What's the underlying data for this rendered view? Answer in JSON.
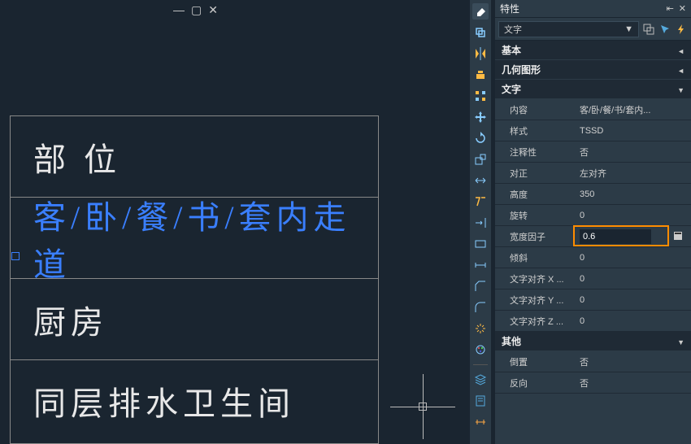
{
  "window_controls": {
    "min": "—",
    "restore": "▢",
    "close": "✕"
  },
  "canvas": {
    "rows": [
      "部 位",
      "客/卧/餐/书/套内走道",
      "厨房",
      "同层排水卫生间"
    ],
    "selected_index": 1
  },
  "panel": {
    "title": "特性",
    "selection_type": "文字",
    "dropdown_caret": "▼",
    "sections": {
      "basic": "基本",
      "geometry": "几何图形",
      "text": "文字",
      "other": "其他"
    },
    "text_props": {
      "content_label": "内容",
      "content": "客/卧/餐/书/套内...",
      "style_label": "样式",
      "style": "TSSD",
      "annotative_label": "注释性",
      "annotative": "否",
      "justify_label": "对正",
      "justify": "左对齐",
      "height_label": "高度",
      "height": "350",
      "rotation_label": "旋转",
      "rotation": "0",
      "width_factor_label": "宽度因子",
      "width_factor": "0.6",
      "oblique_label": "倾斜",
      "oblique": "0",
      "align_x_label": "文字对齐 X ...",
      "align_x": "0",
      "align_y_label": "文字对齐 Y ...",
      "align_y": "0",
      "align_z_label": "文字对齐 Z ...",
      "align_z": "0"
    },
    "other_props": {
      "upside_label": "倒置",
      "upside": "否",
      "backwards_label": "反向",
      "backwards": "否"
    }
  }
}
